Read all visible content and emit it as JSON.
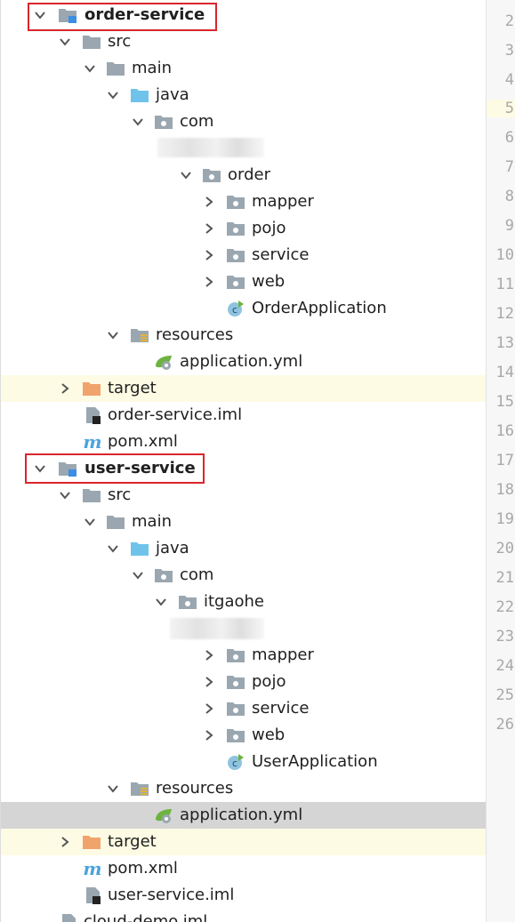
{
  "tree": {
    "order_module": "order-service",
    "order_src": "src",
    "order_main": "main",
    "order_java": "java",
    "order_com": "com",
    "order_order": "order",
    "order_mapper": "mapper",
    "order_pojo": "pojo",
    "order_service_pkg": "service",
    "order_web": "web",
    "order_app": "OrderApplication",
    "order_resources": "resources",
    "order_yml": "application.yml",
    "order_target": "target",
    "order_iml": "order-service.iml",
    "order_pom": "pom.xml",
    "user_module": "user-service",
    "user_src": "src",
    "user_main": "main",
    "user_java": "java",
    "user_com": "com",
    "user_itgaohe": "itgaohe",
    "user_mapper": "mapper",
    "user_pojo": "pojo",
    "user_service_pkg": "service",
    "user_web": "web",
    "user_app": "UserApplication",
    "user_resources": "resources",
    "user_yml": "application.yml",
    "user_target": "target",
    "user_pom": "pom.xml",
    "user_iml": "user-service.iml",
    "cloud_iml": "cloud-demo.iml"
  },
  "gutter": {
    "lines": [
      "2",
      "3",
      "4",
      "5",
      "6",
      "7",
      "8",
      "9",
      "10",
      "11",
      "12",
      "13",
      "14",
      "15",
      "16",
      "17",
      "18",
      "19",
      "20",
      "21",
      "22",
      "23",
      "24",
      "25",
      "26"
    ]
  },
  "colors": {
    "annotation_box": "#d9262b",
    "target_row": "#fdfbe4",
    "selected_row": "#d5d5d5",
    "folder": "#9aa7b0",
    "source_folder": "#6fc3ea",
    "excluded_folder": "#f0a36b",
    "module_badge": "#3a8ee6",
    "spring": "#6db33f"
  }
}
